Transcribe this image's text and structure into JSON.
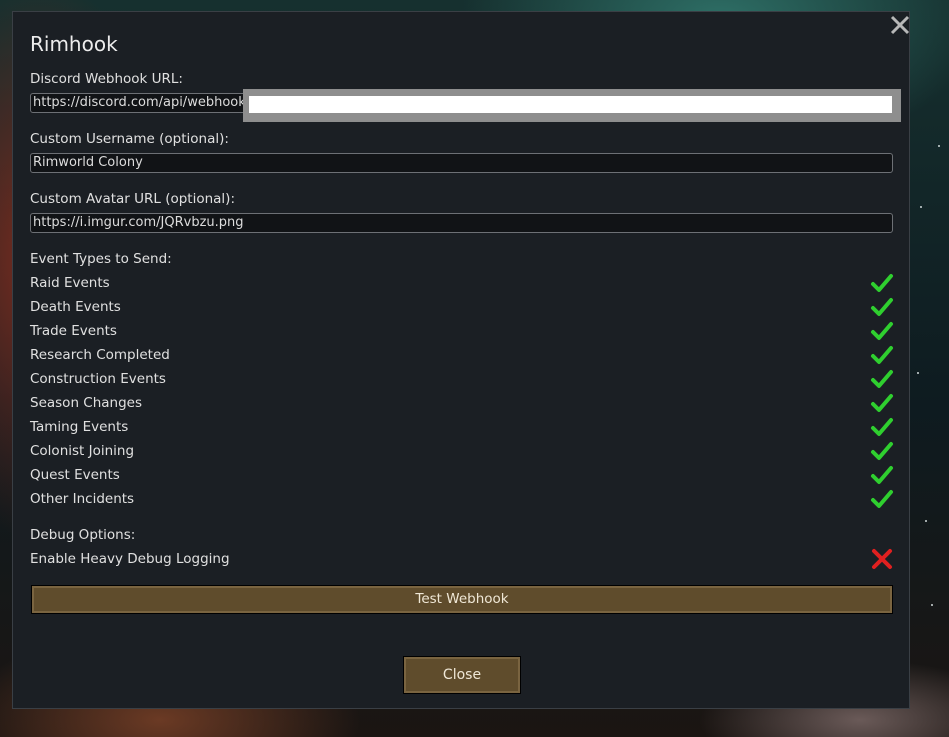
{
  "dialog": {
    "title": "Rimhook",
    "close_icon": "close-x-icon"
  },
  "webhook": {
    "label": "Discord Webhook URL:",
    "value": "https://discord.com/api/webhooks"
  },
  "username": {
    "label": "Custom Username (optional):",
    "value": "Rimworld Colony"
  },
  "avatar": {
    "label": "Custom Avatar URL (optional):",
    "value": "https://i.imgur.com/JQRvbzu.png"
  },
  "events": {
    "heading": "Event Types to Send:",
    "items": [
      {
        "label": "Raid Events",
        "enabled": true
      },
      {
        "label": "Death Events",
        "enabled": true
      },
      {
        "label": "Trade Events",
        "enabled": true
      },
      {
        "label": "Research Completed",
        "enabled": true
      },
      {
        "label": "Construction Events",
        "enabled": true
      },
      {
        "label": "Season Changes",
        "enabled": true
      },
      {
        "label": "Taming Events",
        "enabled": true
      },
      {
        "label": "Colonist Joining",
        "enabled": true
      },
      {
        "label": "Quest Events",
        "enabled": true
      },
      {
        "label": "Other Incidents",
        "enabled": true
      }
    ]
  },
  "debug": {
    "heading": "Debug Options:",
    "heavy_logging": {
      "label": "Enable Heavy Debug Logging",
      "enabled": false
    }
  },
  "buttons": {
    "test": "Test Webhook",
    "close": "Close"
  },
  "colors": {
    "check_on": "#2fcf2f",
    "check_off": "#e02020",
    "button_bg": "#5f4c2c"
  }
}
